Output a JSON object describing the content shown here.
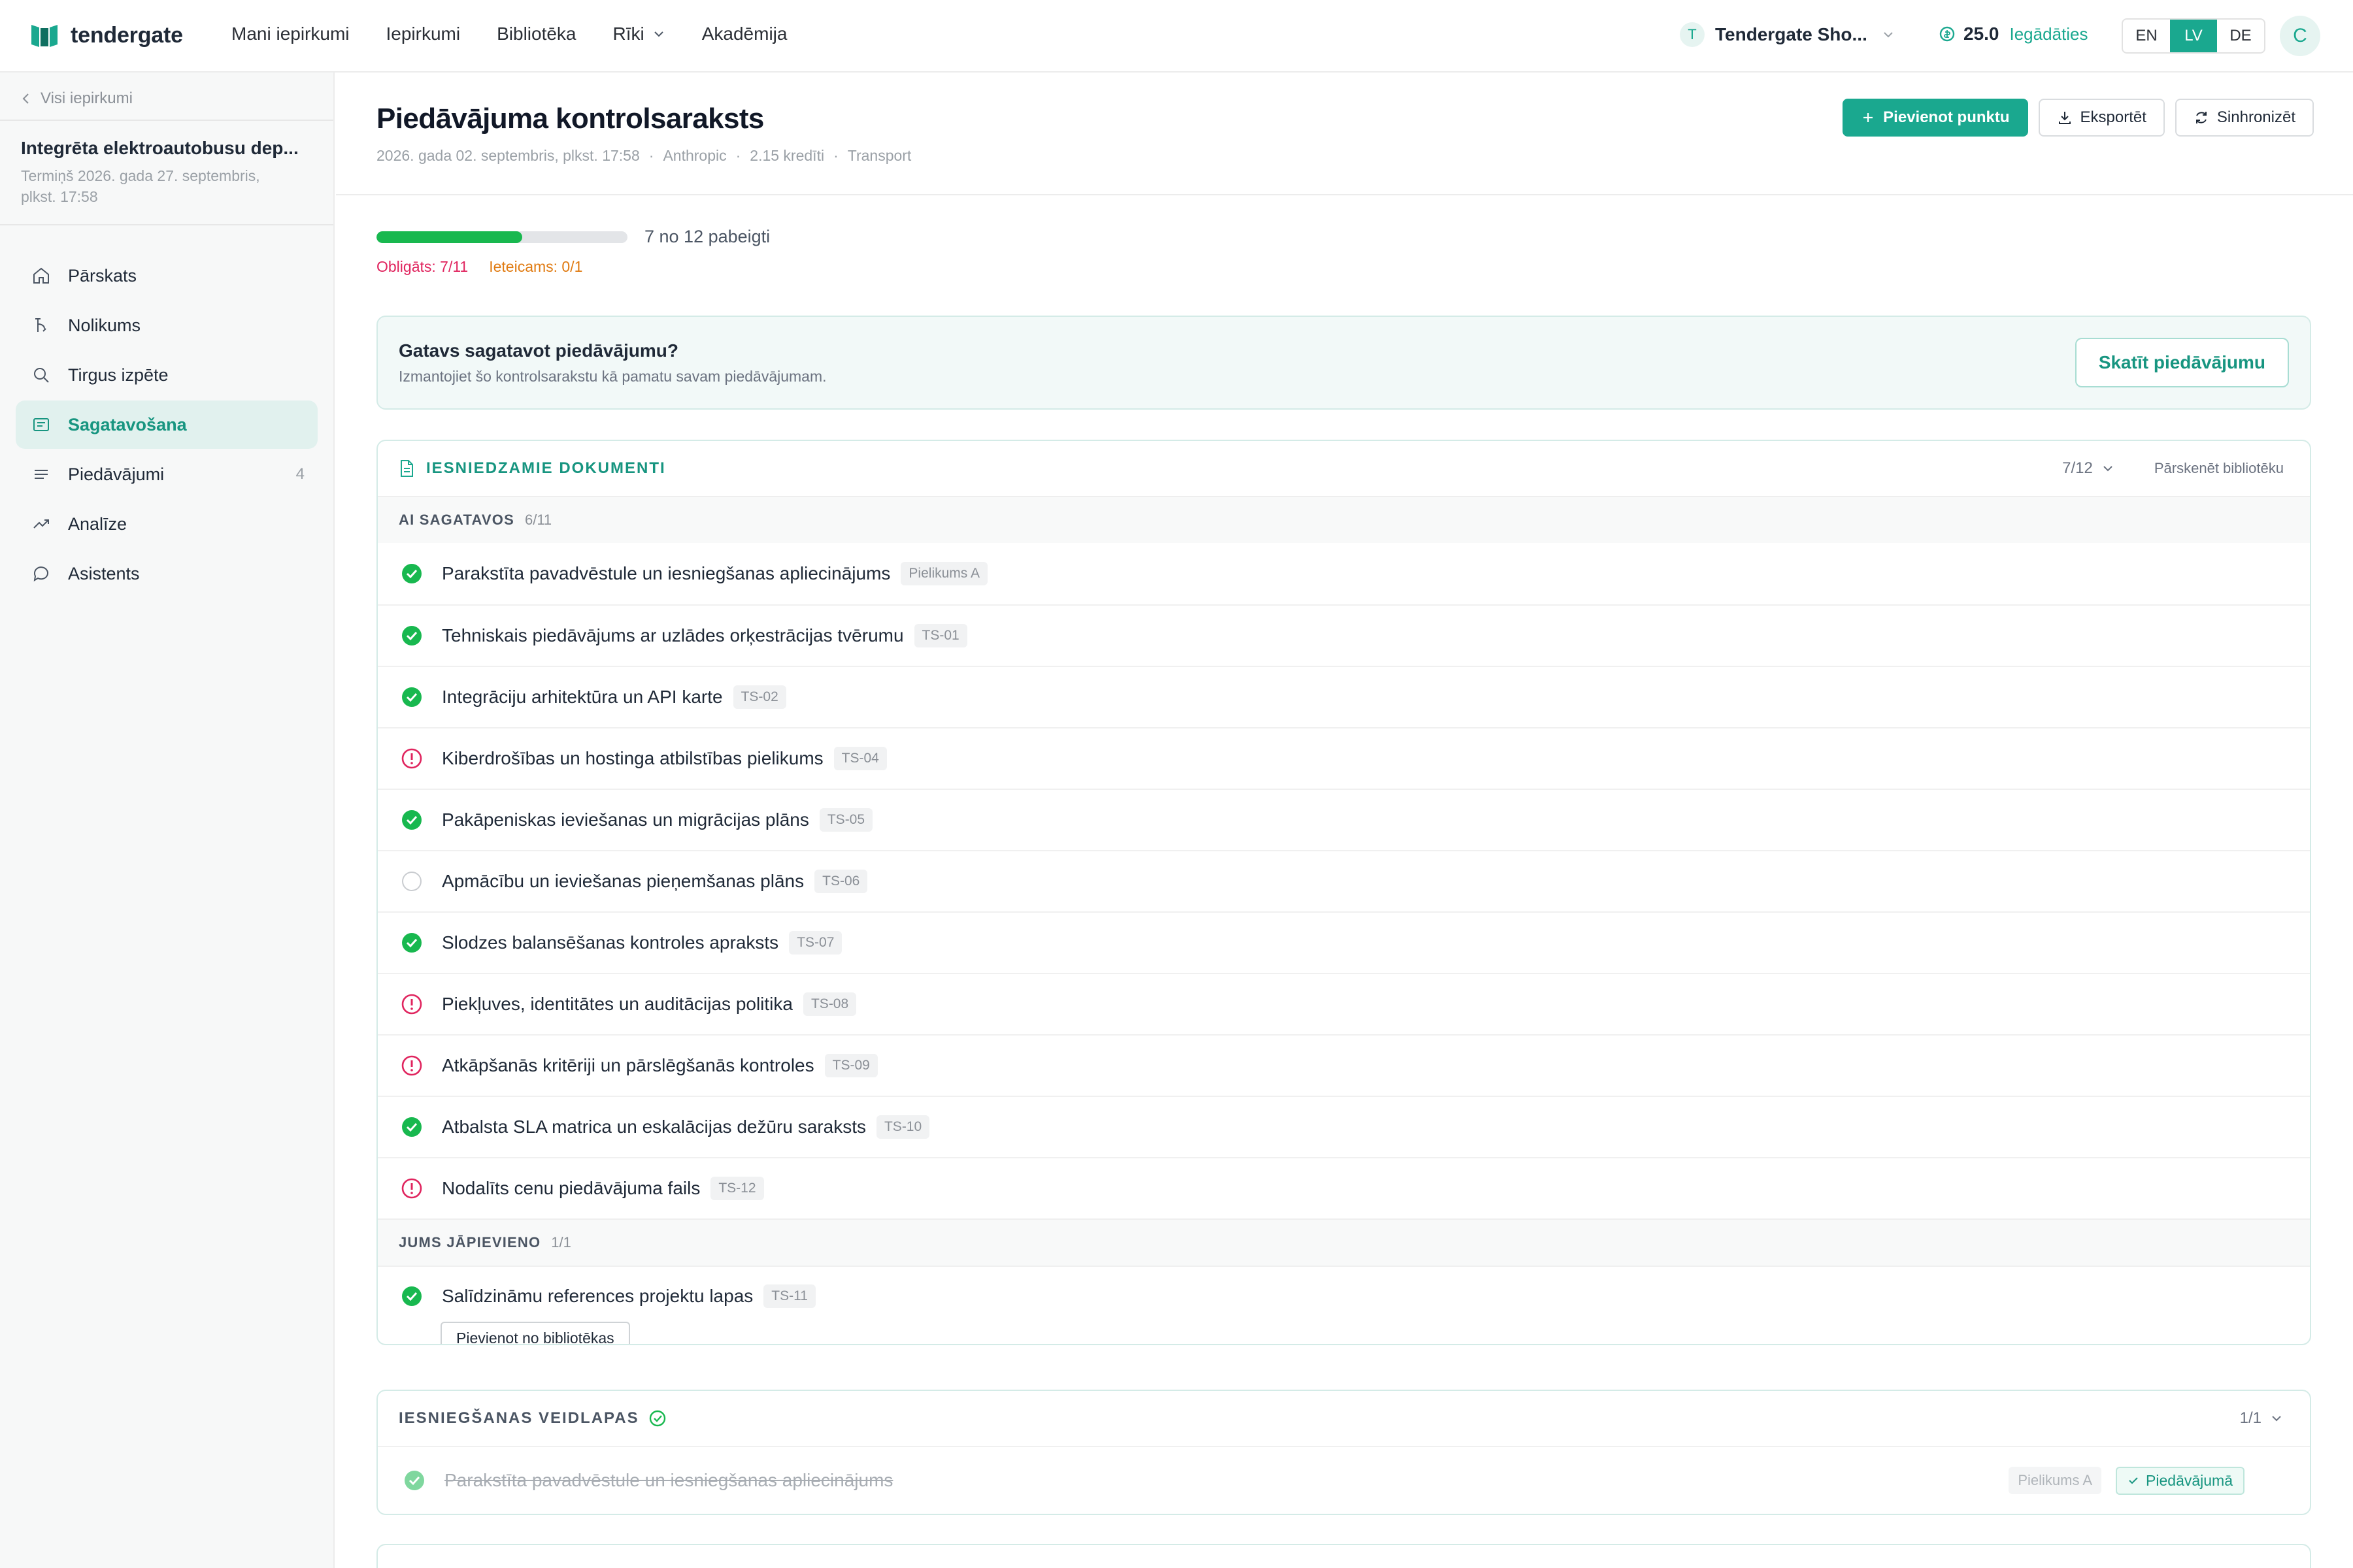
{
  "brand": {
    "name": "tendergate"
  },
  "nav": {
    "links": [
      "Mani iepirkumi",
      "Iepirkumi",
      "Bibliotēka",
      "Rīki",
      "Akadēmija"
    ],
    "tenant_initial": "T",
    "tenant_name": "Tendergate Sho...",
    "credits_value": "25.0",
    "credits_link": "Iegādāties",
    "languages": [
      "EN",
      "LV",
      "DE"
    ],
    "active_language": "LV",
    "avatar_initial": "C"
  },
  "sidebar": {
    "back_label": "Visi iepirkumi",
    "project_title": "Integrēta elektroautobusu dep...",
    "project_deadline": "Termiņš 2026. gada 27. septembris, plkst. 17:58",
    "items": [
      {
        "label": "Pārskats",
        "icon": "home-icon"
      },
      {
        "label": "Nolikums",
        "icon": "scale-icon"
      },
      {
        "label": "Tirgus izpēte",
        "icon": "search-icon"
      },
      {
        "label": "Sagatavošana",
        "icon": "document-list-icon",
        "active": true
      },
      {
        "label": "Piedāvājumi",
        "icon": "list-icon",
        "count": "4"
      },
      {
        "label": "Analīze",
        "icon": "trend-icon"
      },
      {
        "label": "Asistents",
        "icon": "chat-icon"
      }
    ]
  },
  "header": {
    "title": "Piedāvājuma kontrolsaraksts",
    "meta": [
      "2026. gada 02. septembris, plkst. 17:58",
      "Anthropic",
      "2.15 kredīti",
      "Transport"
    ],
    "add_button": "Pievienot punktu",
    "export_button": "Eksportēt",
    "sync_button": "Sinhronizēt"
  },
  "progress": {
    "fraction": 0.58,
    "text": "7 no 12 pabeigti",
    "mandatory": "Obligāts: 7/11",
    "recommended": "Ieteicams: 0/1"
  },
  "ready": {
    "title": "Gatavs sagatavot piedāvājumu?",
    "subtitle": "Izmantojiet šo kontrolsarakstu kā pamatu savam piedāvājumam.",
    "button": "Skatīt piedāvājumu"
  },
  "documents": {
    "title": "IESNIEDZAMIE DOKUMENTI",
    "count": "7/12",
    "library_link": "Pārskenēt bibliotēku",
    "ai_group": {
      "name": "AI SAGATAVOS",
      "count": "6/11"
    },
    "ai_items": [
      {
        "name": "Parakstīta pavadvēstule un iesniegšanas apliecinājums",
        "tag": "Pielikums A",
        "status": "done"
      },
      {
        "name": "Tehniskais piedāvājums ar uzlādes orķestrācijas tvērumu",
        "tag": "TS-01",
        "status": "done"
      },
      {
        "name": "Integrāciju arhitektūra un API karte",
        "tag": "TS-02",
        "status": "done"
      },
      {
        "name": "Kiberdrošības un hostinga atbilstības pielikums",
        "tag": "TS-04",
        "status": "warning"
      },
      {
        "name": "Pakāpeniskas ieviešanas un migrācijas plāns",
        "tag": "TS-05",
        "status": "done"
      },
      {
        "name": "Apmācību un ieviešanas pieņemšanas plāns",
        "tag": "TS-06",
        "status": "empty"
      },
      {
        "name": "Slodzes balansēšanas kontroles apraksts",
        "tag": "TS-07",
        "status": "done"
      },
      {
        "name": "Piekļuves, identitātes un auditācijas politika",
        "tag": "TS-08",
        "status": "warning"
      },
      {
        "name": "Atkāpšanās kritēriji un pārslēgšanās kontroles",
        "tag": "TS-09",
        "status": "warning"
      },
      {
        "name": "Atbalsta SLA matrica un eskalācijas dežūru saraksts",
        "tag": "TS-10",
        "status": "done"
      },
      {
        "name": "Nodalīts cenu piedāvājuma fails",
        "tag": "TS-12",
        "status": "warning"
      }
    ],
    "user_group": {
      "name": "JUMS JĀPIEVIENO",
      "count": "1/1"
    },
    "user_item": {
      "name": "Salīdzināmu references projektu lapas",
      "tag": "TS-11",
      "status": "done",
      "button": "Pievienot no bibliotēkas"
    }
  },
  "forms": {
    "title": "IESNIEGŠANAS VEIDLAPAS",
    "count": "1/1",
    "item": {
      "name": "Parakstīta pavadvēstule un iesniegšanas apliecinājums",
      "tag": "Pielikums A",
      "badge": "Piedāvājumā"
    }
  },
  "colors": {
    "accent": "#1aa88f",
    "success": "#18b84f",
    "danger": "#e0245e",
    "warning": "#e07b12"
  }
}
